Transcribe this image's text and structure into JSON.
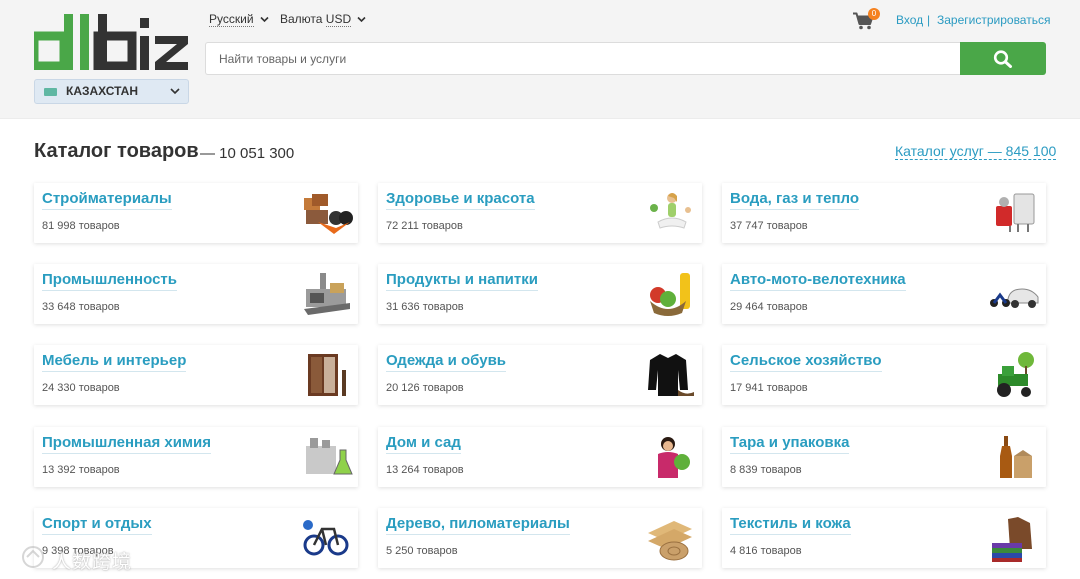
{
  "header": {
    "logo": "allbiz",
    "region": "КАЗАХСТАН",
    "language": "Русский",
    "currency_label": "Валюта",
    "currency_value": "USD",
    "search_placeholder": "Найти товары и услуги",
    "cart_count": "0",
    "login": "Вход",
    "separator": "|",
    "register": "Зарегистрироваться"
  },
  "catalog": {
    "title": "Каталог товаров",
    "count": "— 10 051 300",
    "services_link": "Каталог услуг — 845 100"
  },
  "categories": [
    {
      "name": "Стройматериалы",
      "count": "81 998 товаров",
      "icon": "building-materials-icon"
    },
    {
      "name": "Здоровье и красота",
      "count": "72 211 товаров",
      "icon": "yoga-woman-icon"
    },
    {
      "name": "Вода, газ и тепло",
      "count": "37 747 товаров",
      "icon": "boiler-icon"
    },
    {
      "name": "Промышленность",
      "count": "33 648 товаров",
      "icon": "factory-machine-icon"
    },
    {
      "name": "Продукты и напитки",
      "count": "31 636 товаров",
      "icon": "groceries-icon"
    },
    {
      "name": "Авто-мото-велотехника",
      "count": "29 464 товаров",
      "icon": "car-motorcycle-icon"
    },
    {
      "name": "Мебель и интерьер",
      "count": "24 330 товаров",
      "icon": "wardrobe-icon"
    },
    {
      "name": "Одежда и обувь",
      "count": "20 126 товаров",
      "icon": "jacket-icon"
    },
    {
      "name": "Сельское хозяйство",
      "count": "17 941 товаров",
      "icon": "tractor-icon"
    },
    {
      "name": "Промышленная химия",
      "count": "13 392 товаров",
      "icon": "chemistry-flask-icon"
    },
    {
      "name": "Дом и сад",
      "count": "13 264 товаров",
      "icon": "gardener-woman-icon"
    },
    {
      "name": "Тара и упаковка",
      "count": "8 839 товаров",
      "icon": "bottle-bag-icon"
    },
    {
      "name": "Спорт и отдых",
      "count": "9 398 товаров",
      "icon": "bicycle-icon"
    },
    {
      "name": "Дерево, пиломатериалы",
      "count": "5 250 товаров",
      "icon": "lumber-icon"
    },
    {
      "name": "Текстиль и кожа",
      "count": "4 816 товаров",
      "icon": "leather-fabric-icon"
    }
  ],
  "watermark": "人数跨境",
  "colors": {
    "accent": "#2a9dc0",
    "search_button": "#4aa748",
    "badge": "#f58220",
    "logo_green": "#4aa748",
    "logo_dark": "#333333"
  }
}
